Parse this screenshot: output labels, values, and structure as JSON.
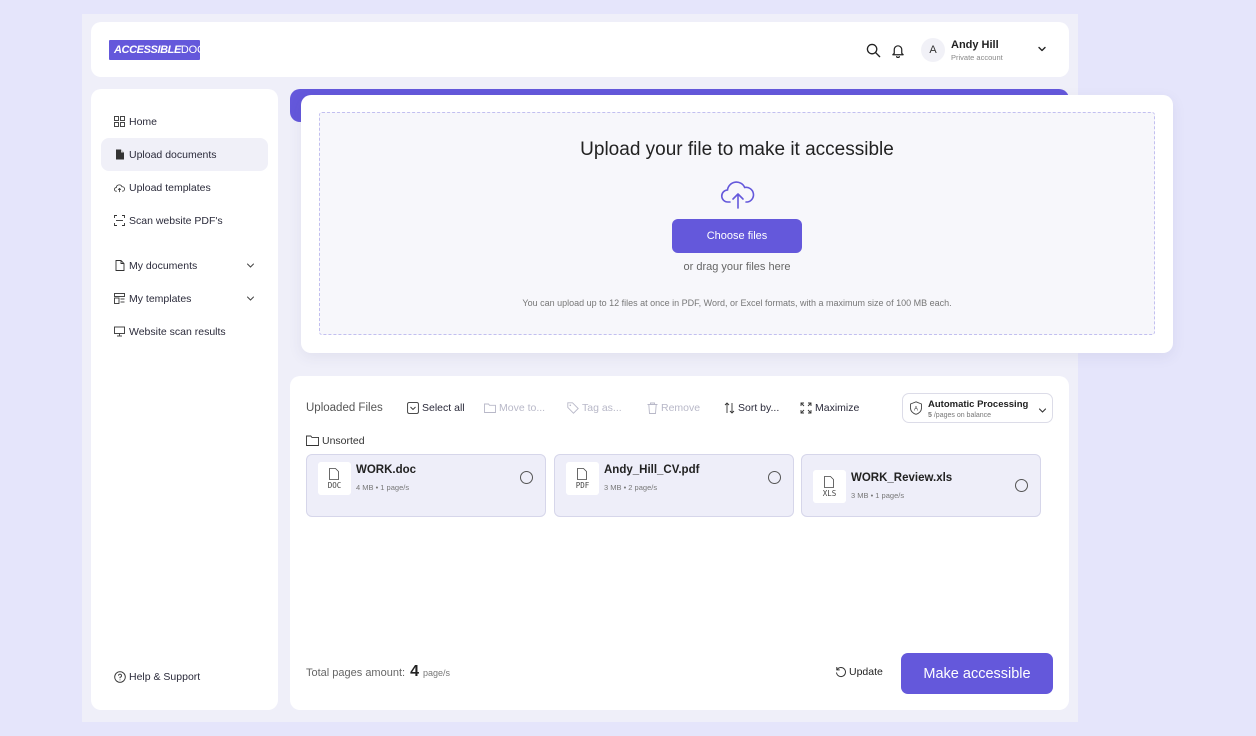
{
  "header": {
    "logo_bold": "ACCESSIBLE",
    "logo_rest": "DOCS",
    "avatar_initial": "A",
    "user_name": "Andy Hill",
    "account_type": "Private account"
  },
  "sidebar": {
    "items": [
      {
        "label": "Home"
      },
      {
        "label": "Upload documents"
      },
      {
        "label": "Upload templates"
      },
      {
        "label": "Scan website PDF's"
      },
      {
        "label": "My documents"
      },
      {
        "label": "My templates"
      },
      {
        "label": "Website scan results"
      }
    ],
    "help_label": "Help & Support"
  },
  "upload": {
    "title": "Upload your file to make it accessible",
    "button_label": "Choose files",
    "drag_text": "or drag your files here",
    "hint": "You can upload up to 12 files at once in PDF, Word, or Excel formats, with a maximum size of 100 MB each."
  },
  "files": {
    "title": "Uploaded Files",
    "toolbar": {
      "select_all": "Select all",
      "move_to": "Move to...",
      "tag_as": "Tag as...",
      "remove": "Remove",
      "sort_by": "Sort by...",
      "maximize": "Maximize"
    },
    "processing": {
      "title": "Automatic Processing",
      "balance_count": "5",
      "balance_text": "/pages on balance"
    },
    "folder": "Unsorted",
    "items": [
      {
        "name": "WORK.doc",
        "ext": "DOC",
        "meta": "4 MB • 1 page/s"
      },
      {
        "name": "Andy_Hill_CV.pdf",
        "ext": "PDF",
        "meta": "3 MB • 2 page/s"
      },
      {
        "name": "WORK_Review.xls",
        "ext": "XLS",
        "meta": "3 MB • 1 page/s"
      }
    ],
    "total_label": "Total pages amount:",
    "total_value": "4",
    "total_unit": "page/s",
    "update_label": "Update",
    "make_label": "Make accessible"
  },
  "colors": {
    "accent": "#6458db",
    "background": "#e5e5fb",
    "file_card": "#eeeef9"
  },
  "icons": [
    "search-icon",
    "bell-icon",
    "chevron-down-icon",
    "home-grid-icon",
    "document-icon",
    "cloud-upload-icon",
    "scan-icon",
    "template-icon",
    "monitor-icon",
    "help-icon",
    "checkbox-icon",
    "folder-icon",
    "tag-icon",
    "trash-icon",
    "sort-icon",
    "maximize-icon",
    "shield-icon",
    "refresh-icon",
    "file-icon"
  ]
}
